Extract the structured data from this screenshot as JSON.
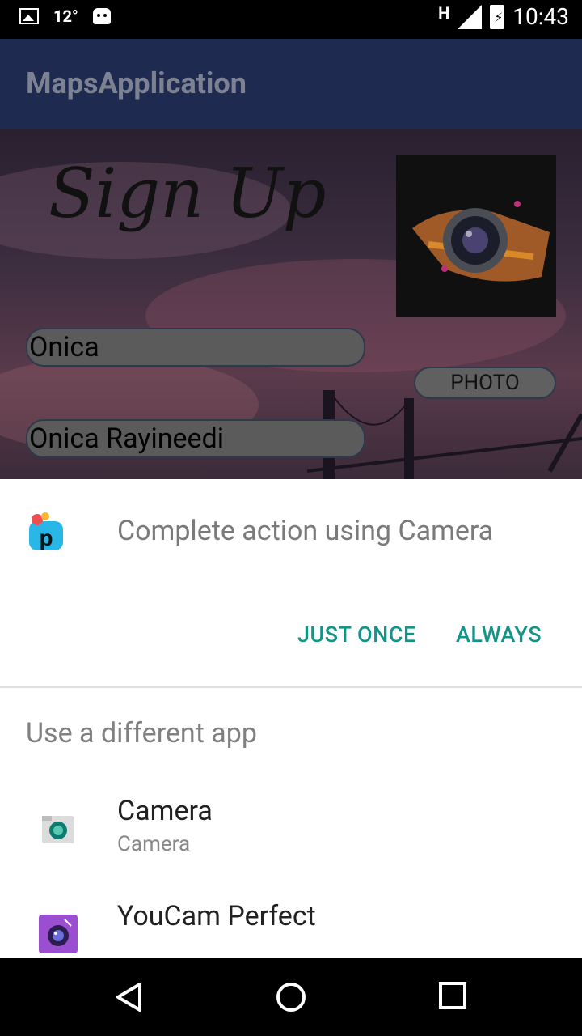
{
  "status_bar": {
    "temperature": "12°",
    "network": "H",
    "time": "10:43",
    "icons": [
      "image-icon",
      "android-icon",
      "signal-icon",
      "battery-charging-icon"
    ]
  },
  "app_bar": {
    "title": "MapsApplication"
  },
  "form": {
    "heading": "Sign Up",
    "username_value": "Onica",
    "fullname_value": "Onica Rayineedi",
    "photo_button": "PHOTO"
  },
  "chooser": {
    "title": "Complete action using Camera",
    "just_once": "JUST ONCE",
    "always": "ALWAYS",
    "different_app_label": "Use a different app",
    "apps": [
      {
        "name": "Camera",
        "subtitle": "Camera",
        "icon": "camera-app-icon"
      },
      {
        "name": "YouCam Perfect",
        "subtitle": "",
        "icon": "youcam-icon"
      }
    ],
    "colors": {
      "accent": "#129488"
    }
  },
  "nav_bar": {
    "icons": [
      "back-icon",
      "home-icon",
      "recents-icon"
    ]
  }
}
